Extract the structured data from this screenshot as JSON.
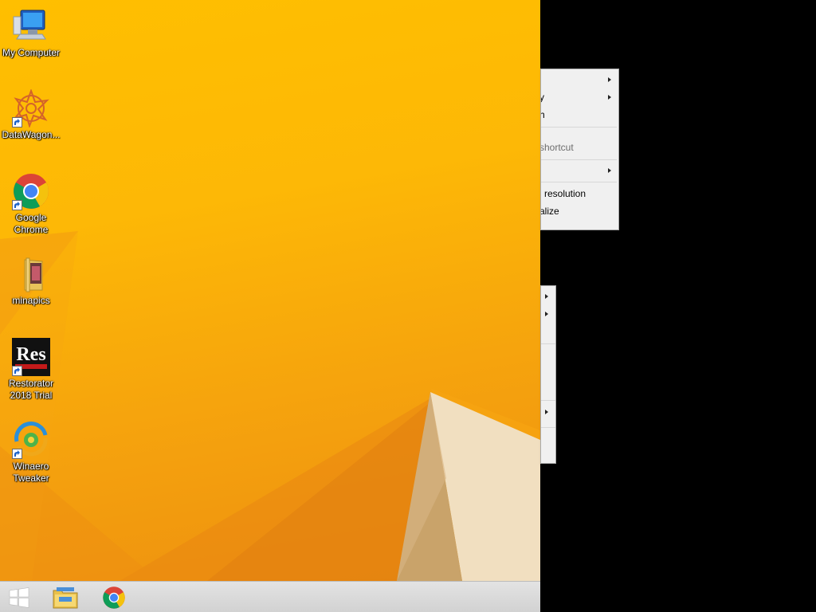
{
  "desktop_icons": [
    {
      "label": "My Computer",
      "icon": "my-computer-icon",
      "shortcut": false
    },
    {
      "label": "DataWagon...",
      "icon": "datawagon-icon",
      "shortcut": true
    },
    {
      "label": "Google Chrome",
      "icon": "chrome-icon",
      "shortcut": true
    },
    {
      "label": "minapics",
      "icon": "folder-icon",
      "shortcut": false
    },
    {
      "label": "Restorator 2018 Trial",
      "icon": "restorator-icon",
      "shortcut": true
    },
    {
      "label": "Winaero Tweaker",
      "icon": "winaero-icon",
      "shortcut": true
    }
  ],
  "restorator_logo_text": "Res",
  "context_menu_main": {
    "items": [
      {
        "label": "",
        "submenu": true
      },
      {
        "label": "y",
        "submenu": true
      },
      {
        "label": "h",
        "submenu": false
      },
      {
        "label": "shortcut",
        "submenu": false,
        "disabled": true
      },
      {
        "label": "",
        "submenu": true
      },
      {
        "label": "resolution",
        "submenu": false
      },
      {
        "label": "alize",
        "submenu": false
      }
    ]
  },
  "context_menu_secondary": {
    "items": [
      {
        "label": "",
        "submenu": true
      },
      {
        "label": "",
        "submenu": true
      },
      {
        "label": "",
        "submenu": true
      }
    ]
  },
  "taskbar": {
    "start": "windows-logo-icon",
    "pinned": [
      "file-explorer-icon",
      "chrome-icon"
    ]
  },
  "colors": {
    "wallpaper": "#fdb806",
    "wallpaper_dark": "#ed8f10",
    "taskbar": "#d9d9d9",
    "menu_bg": "#f0f0f0"
  }
}
